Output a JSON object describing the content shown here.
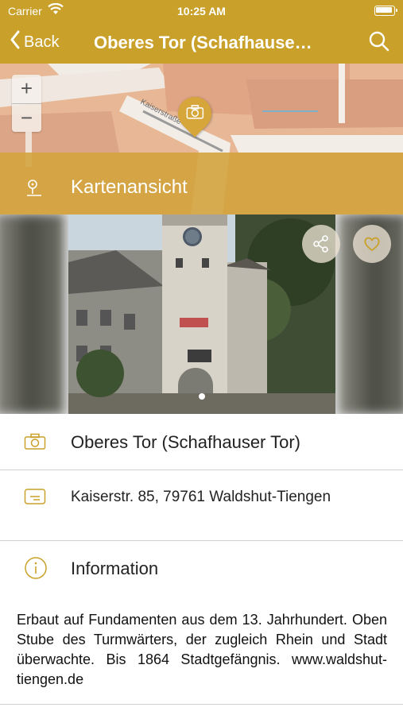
{
  "status_bar": {
    "carrier": "Carrier",
    "time": "10:25 AM"
  },
  "nav": {
    "back_label": "Back",
    "title": "Oberes Tor (Schafhauser Tor)"
  },
  "map": {
    "street_label": "Kaiserstraße",
    "zoom_in": "+",
    "zoom_out": "−",
    "map_view_label": "Kartenansicht"
  },
  "details": {
    "name": "Oberes Tor (Schafhauser Tor)",
    "address": "Kaiserstr. 85, 79761 Waldshut-Tiengen",
    "info_heading": "Information",
    "description": "Erbaut auf Fundamenten aus dem 13. Jahrhundert. Oben Stube des Turmwärters, der zugleich Rhein und Stadt überwachte. Bis 1864 Stadtgefängnis. www.waldshut-tiengen.de"
  },
  "colors": {
    "accent": "#c9a12a",
    "icon_gold": "#c9a12a"
  },
  "icons": [
    "chevron-left-icon",
    "search-icon",
    "wifi-icon",
    "battery-icon",
    "camera-icon",
    "location-pin-icon",
    "share-icon",
    "heart-icon",
    "address-card-icon",
    "info-icon"
  ]
}
